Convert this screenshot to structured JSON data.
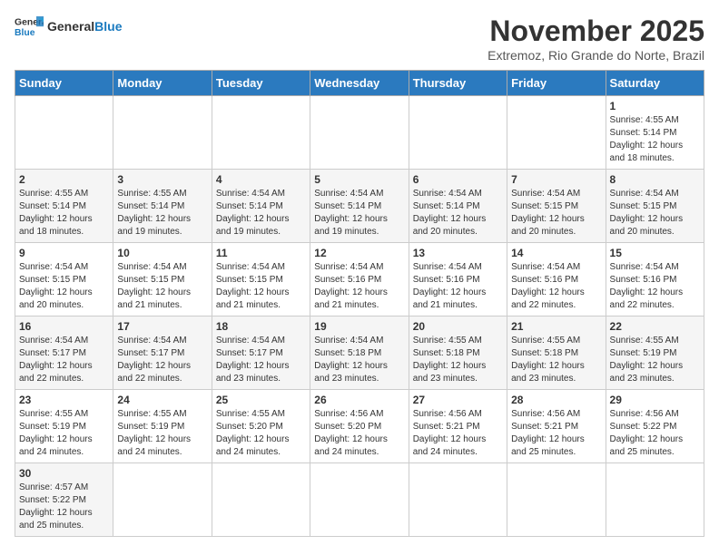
{
  "header": {
    "logo_general": "General",
    "logo_blue": "Blue",
    "title": "November 2025",
    "subtitle": "Extremoz, Rio Grande do Norte, Brazil"
  },
  "weekdays": [
    "Sunday",
    "Monday",
    "Tuesday",
    "Wednesday",
    "Thursday",
    "Friday",
    "Saturday"
  ],
  "weeks": [
    [
      {
        "day": "",
        "info": ""
      },
      {
        "day": "",
        "info": ""
      },
      {
        "day": "",
        "info": ""
      },
      {
        "day": "",
        "info": ""
      },
      {
        "day": "",
        "info": ""
      },
      {
        "day": "",
        "info": ""
      },
      {
        "day": "1",
        "info": "Sunrise: 4:55 AM\nSunset: 5:14 PM\nDaylight: 12 hours and 18 minutes."
      }
    ],
    [
      {
        "day": "2",
        "info": "Sunrise: 4:55 AM\nSunset: 5:14 PM\nDaylight: 12 hours and 18 minutes."
      },
      {
        "day": "3",
        "info": "Sunrise: 4:55 AM\nSunset: 5:14 PM\nDaylight: 12 hours and 19 minutes."
      },
      {
        "day": "4",
        "info": "Sunrise: 4:54 AM\nSunset: 5:14 PM\nDaylight: 12 hours and 19 minutes."
      },
      {
        "day": "5",
        "info": "Sunrise: 4:54 AM\nSunset: 5:14 PM\nDaylight: 12 hours and 19 minutes."
      },
      {
        "day": "6",
        "info": "Sunrise: 4:54 AM\nSunset: 5:14 PM\nDaylight: 12 hours and 20 minutes."
      },
      {
        "day": "7",
        "info": "Sunrise: 4:54 AM\nSunset: 5:15 PM\nDaylight: 12 hours and 20 minutes."
      },
      {
        "day": "8",
        "info": "Sunrise: 4:54 AM\nSunset: 5:15 PM\nDaylight: 12 hours and 20 minutes."
      }
    ],
    [
      {
        "day": "9",
        "info": "Sunrise: 4:54 AM\nSunset: 5:15 PM\nDaylight: 12 hours and 20 minutes."
      },
      {
        "day": "10",
        "info": "Sunrise: 4:54 AM\nSunset: 5:15 PM\nDaylight: 12 hours and 21 minutes."
      },
      {
        "day": "11",
        "info": "Sunrise: 4:54 AM\nSunset: 5:15 PM\nDaylight: 12 hours and 21 minutes."
      },
      {
        "day": "12",
        "info": "Sunrise: 4:54 AM\nSunset: 5:16 PM\nDaylight: 12 hours and 21 minutes."
      },
      {
        "day": "13",
        "info": "Sunrise: 4:54 AM\nSunset: 5:16 PM\nDaylight: 12 hours and 21 minutes."
      },
      {
        "day": "14",
        "info": "Sunrise: 4:54 AM\nSunset: 5:16 PM\nDaylight: 12 hours and 22 minutes."
      },
      {
        "day": "15",
        "info": "Sunrise: 4:54 AM\nSunset: 5:16 PM\nDaylight: 12 hours and 22 minutes."
      }
    ],
    [
      {
        "day": "16",
        "info": "Sunrise: 4:54 AM\nSunset: 5:17 PM\nDaylight: 12 hours and 22 minutes."
      },
      {
        "day": "17",
        "info": "Sunrise: 4:54 AM\nSunset: 5:17 PM\nDaylight: 12 hours and 22 minutes."
      },
      {
        "day": "18",
        "info": "Sunrise: 4:54 AM\nSunset: 5:17 PM\nDaylight: 12 hours and 23 minutes."
      },
      {
        "day": "19",
        "info": "Sunrise: 4:54 AM\nSunset: 5:18 PM\nDaylight: 12 hours and 23 minutes."
      },
      {
        "day": "20",
        "info": "Sunrise: 4:55 AM\nSunset: 5:18 PM\nDaylight: 12 hours and 23 minutes."
      },
      {
        "day": "21",
        "info": "Sunrise: 4:55 AM\nSunset: 5:18 PM\nDaylight: 12 hours and 23 minutes."
      },
      {
        "day": "22",
        "info": "Sunrise: 4:55 AM\nSunset: 5:19 PM\nDaylight: 12 hours and 23 minutes."
      }
    ],
    [
      {
        "day": "23",
        "info": "Sunrise: 4:55 AM\nSunset: 5:19 PM\nDaylight: 12 hours and 24 minutes."
      },
      {
        "day": "24",
        "info": "Sunrise: 4:55 AM\nSunset: 5:19 PM\nDaylight: 12 hours and 24 minutes."
      },
      {
        "day": "25",
        "info": "Sunrise: 4:55 AM\nSunset: 5:20 PM\nDaylight: 12 hours and 24 minutes."
      },
      {
        "day": "26",
        "info": "Sunrise: 4:56 AM\nSunset: 5:20 PM\nDaylight: 12 hours and 24 minutes."
      },
      {
        "day": "27",
        "info": "Sunrise: 4:56 AM\nSunset: 5:21 PM\nDaylight: 12 hours and 24 minutes."
      },
      {
        "day": "28",
        "info": "Sunrise: 4:56 AM\nSunset: 5:21 PM\nDaylight: 12 hours and 25 minutes."
      },
      {
        "day": "29",
        "info": "Sunrise: 4:56 AM\nSunset: 5:22 PM\nDaylight: 12 hours and 25 minutes."
      }
    ],
    [
      {
        "day": "30",
        "info": "Sunrise: 4:57 AM\nSunset: 5:22 PM\nDaylight: 12 hours and 25 minutes."
      },
      {
        "day": "",
        "info": ""
      },
      {
        "day": "",
        "info": ""
      },
      {
        "day": "",
        "info": ""
      },
      {
        "day": "",
        "info": ""
      },
      {
        "day": "",
        "info": ""
      },
      {
        "day": "",
        "info": ""
      }
    ]
  ]
}
